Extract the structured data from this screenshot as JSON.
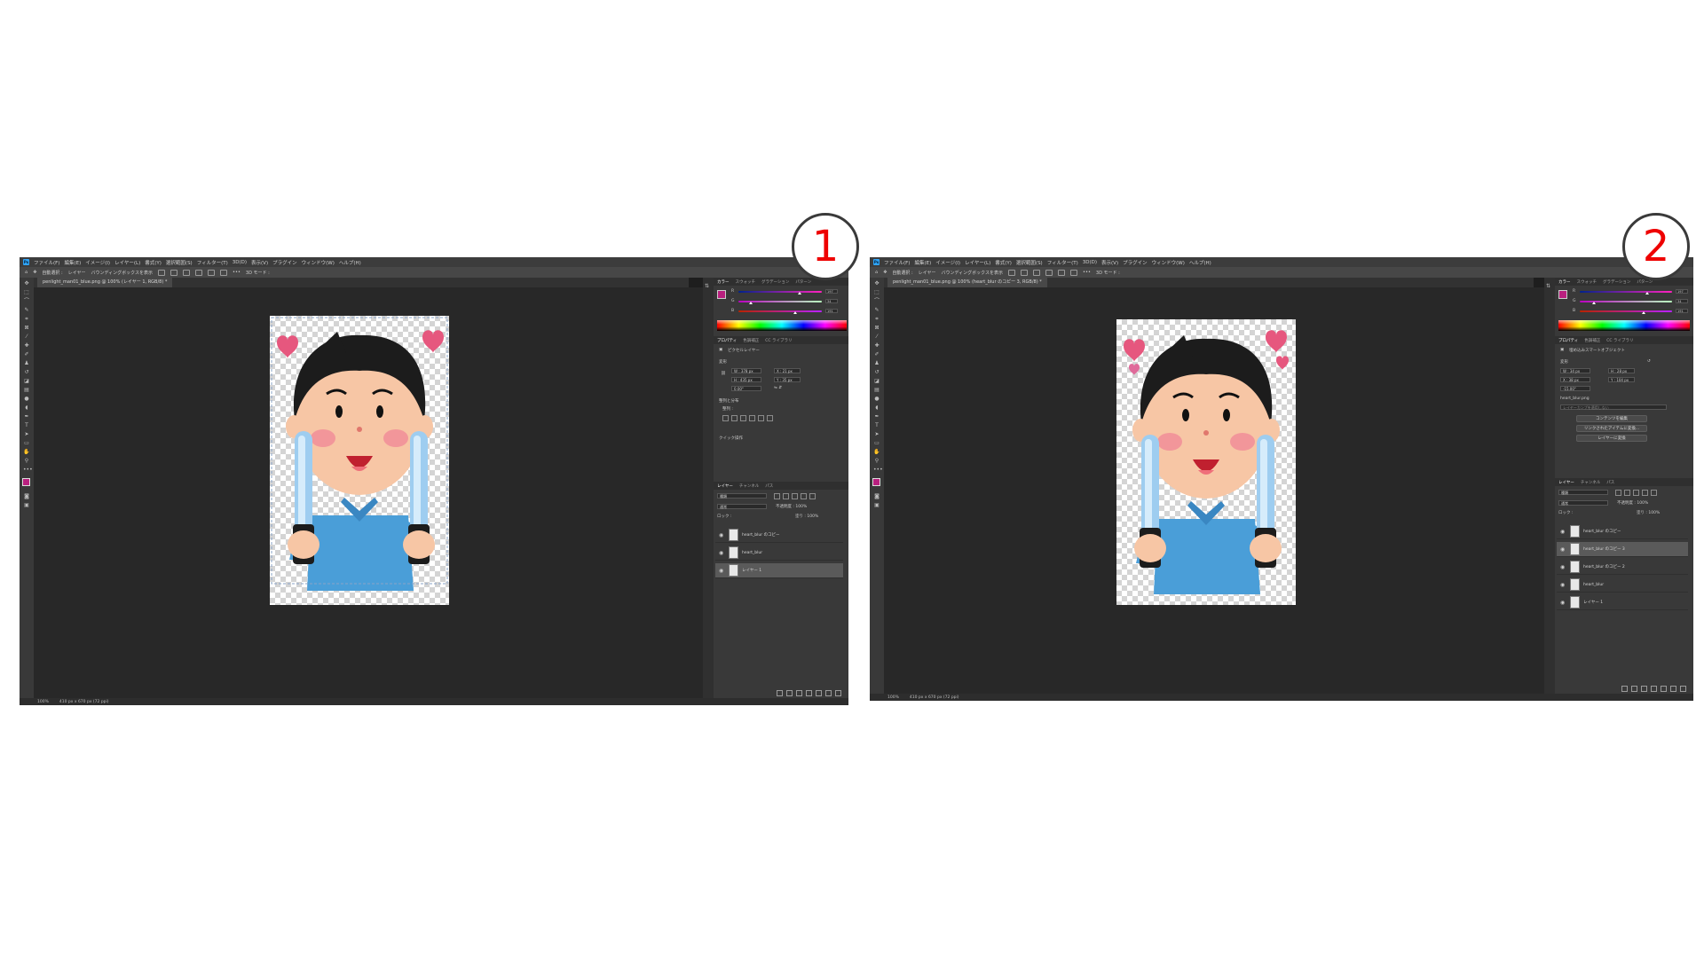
{
  "badges": {
    "left": "1",
    "right": "2"
  },
  "menu": [
    "ファイル(F)",
    "編集(E)",
    "イメージ(I)",
    "レイヤー(L)",
    "書式(Y)",
    "選択範囲(S)",
    "フィルター(T)",
    "3D(D)",
    "表示(V)",
    "プラグイン",
    "ウィンドウ(W)",
    "ヘルプ(H)"
  ],
  "options": {
    "autoselect": "自動選択 :",
    "layer_mode": "レイヤー",
    "bbox": "バウンディングボックスを表示",
    "mode3d": "3D モード :"
  },
  "colors": {
    "accent": "#ee0000",
    "fg_swatch": "#b9207f",
    "doc_tab": "#484848"
  },
  "screen1": {
    "doc_tab": "penlight_man01_blue.png @ 100% (レイヤー 1, RGB/8) *",
    "status": [
      "100%",
      "410 px x 670 px (72 ppi)"
    ],
    "color_tabs": [
      "カラー",
      "スウォッチ",
      "グラデーション",
      "パターン"
    ],
    "rgb": {
      "r": "197",
      "g": "34",
      "b": "191"
    },
    "prop_tabs": [
      "プロパティ",
      "色調補正",
      "CC ライブラリ"
    ],
    "pixel_layer": "ピクセルレイヤー",
    "transform": "変形",
    "w": "W : 378 px",
    "h": "H : 435 px",
    "x": "X : 21 px",
    "y": "Y : 35 px",
    "angle": "0.00°",
    "align": "整列と分布",
    "align_sub": "整列 :",
    "quick": "クイック操作",
    "layer_tabs": [
      "レイヤー",
      "チャンネル",
      "パス"
    ],
    "kind": "種類",
    "blend": "通常",
    "opacity": "不透明度 : 100%",
    "fill": "塗り : 100%",
    "lock": "ロック :",
    "layers": [
      {
        "name": "heart_blur のコピー",
        "selected": false
      },
      {
        "name": "heart_blur",
        "selected": false
      },
      {
        "name": "レイヤー 1",
        "selected": true
      }
    ]
  },
  "screen2": {
    "doc_tab": "penlight_man01_blue.png @ 100% (heart_blur のコピー 3, RGB/8) *",
    "status": [
      "100%",
      "410 px x 670 px (72 ppi)"
    ],
    "color_tabs": [
      "カラー",
      "スウォッチ",
      "グラデーション",
      "パターン"
    ],
    "rgb": {
      "r": "197",
      "g": "34",
      "b": "191"
    },
    "prop_tabs": [
      "プロパティ",
      "色調補正",
      "CC ライブラリ"
    ],
    "smart_object": "埋め込みスマートオブジェクト",
    "transform": "変形",
    "w": "W : 34 px",
    "h": "H : 28 px",
    "x": "X : 38 px",
    "y": "Y : 104 px",
    "angle": "-15.00°",
    "file": "heart_blur.png",
    "comp": "レイヤーカンプを適用しない",
    "btn_edit": "コンテンツを編集",
    "btn_link": "リンクされたアイテムに変換...",
    "btn_layer": "レイヤーに変換",
    "layer_tabs": [
      "レイヤー",
      "チャンネル",
      "パス"
    ],
    "kind": "種類",
    "blend": "通常",
    "opacity": "不透明度 : 100%",
    "fill": "塗り : 100%",
    "lock": "ロック :",
    "layers": [
      {
        "name": "heart_blur のコピー",
        "selected": false
      },
      {
        "name": "heart_blur のコピー 3",
        "selected": true
      },
      {
        "name": "heart_blur のコピー 2",
        "selected": false
      },
      {
        "name": "heart_blur",
        "selected": false
      },
      {
        "name": "レイヤー 1",
        "selected": false
      }
    ]
  }
}
